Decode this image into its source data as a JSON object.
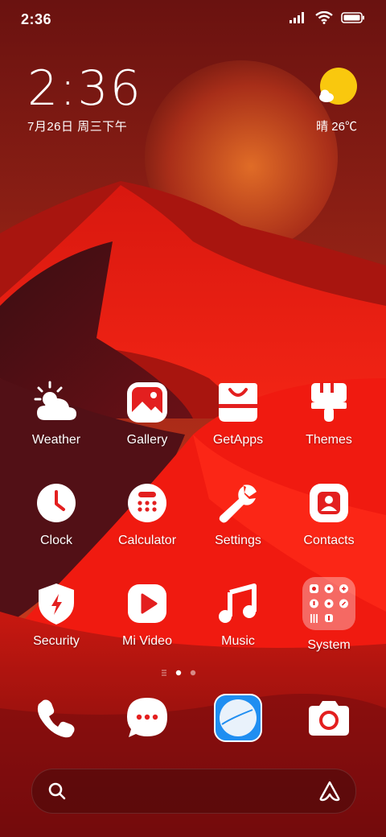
{
  "status_bar": {
    "time": "2:36",
    "icons": [
      "signal-icon",
      "wifi-icon",
      "battery-icon"
    ]
  },
  "clock_widget": {
    "time": "2:36",
    "date": "7月26日 周三下午"
  },
  "weather_widget": {
    "icon": "sunny-cloud-icon",
    "text": "晴 26℃"
  },
  "home_apps": [
    {
      "label": "Weather",
      "icon": "weather-icon"
    },
    {
      "label": "Gallery",
      "icon": "gallery-icon"
    },
    {
      "label": "GetApps",
      "icon": "getapps-icon"
    },
    {
      "label": "Themes",
      "icon": "themes-icon"
    },
    {
      "label": "Clock",
      "icon": "clock-icon"
    },
    {
      "label": "Calculator",
      "icon": "calculator-icon"
    },
    {
      "label": "Settings",
      "icon": "settings-icon"
    },
    {
      "label": "Contacts",
      "icon": "contacts-icon"
    },
    {
      "label": "Security",
      "icon": "security-icon"
    },
    {
      "label": "Mi Video",
      "icon": "mi-video-icon"
    },
    {
      "label": "Music",
      "icon": "music-icon"
    },
    {
      "label": "System",
      "icon": "system-folder-icon"
    }
  ],
  "page_indicator": {
    "pages": 2,
    "active": 1
  },
  "dock": [
    {
      "icon": "phone-icon"
    },
    {
      "icon": "messages-icon"
    },
    {
      "icon": "browser-icon"
    },
    {
      "icon": "camera-icon"
    }
  ],
  "search_bar": {
    "left_icon": "search-icon",
    "right_icon": "assistant-icon"
  },
  "colors": {
    "accent_red": "#e31f1f",
    "sun_yellow": "#f9c80e",
    "browser_blue": "#1f8ef1"
  }
}
